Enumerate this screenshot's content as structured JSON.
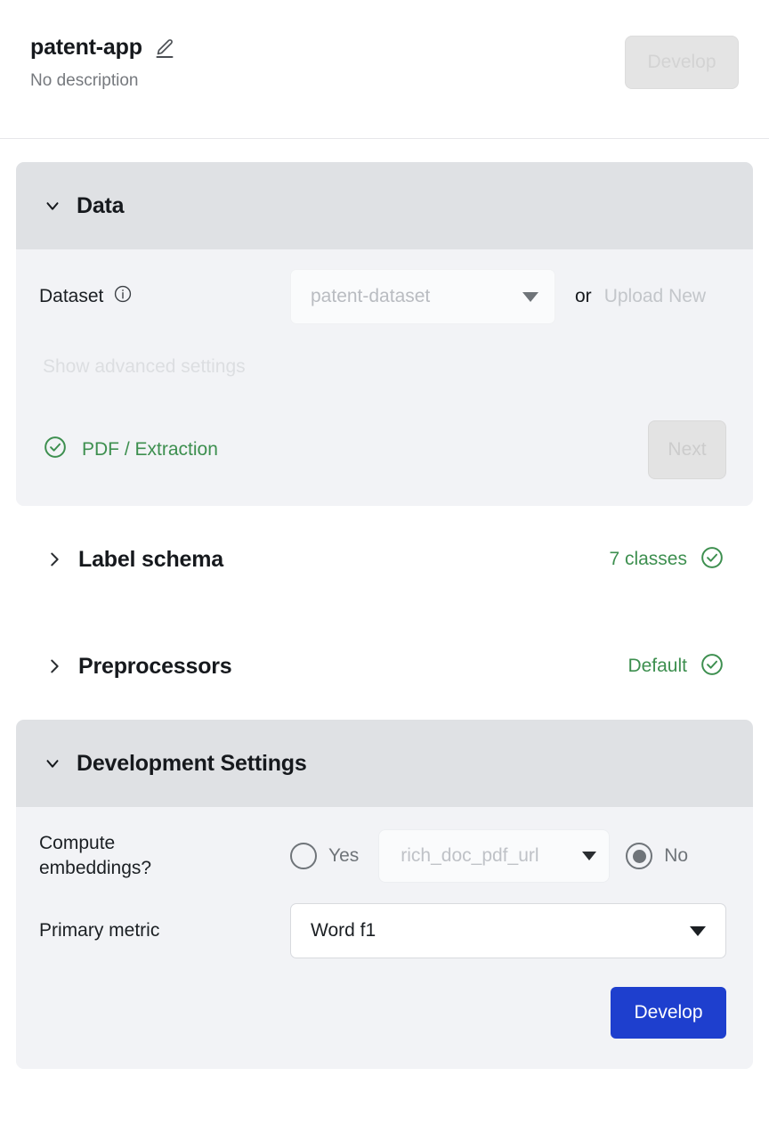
{
  "header": {
    "title": "patent-app",
    "subtitle": "No description",
    "edit_icon": "pencil-edit-icon",
    "develop_label": "Develop",
    "develop_disabled": true
  },
  "data_section": {
    "title": "Data",
    "expanded": true,
    "chevron": "chevron-down-icon",
    "dataset": {
      "label": "Dataset",
      "info_icon": "info-circle-icon",
      "value": "patent-dataset",
      "disabled": true,
      "or_text": "or",
      "upload_label": "Upload New",
      "upload_disabled": true
    },
    "advanced_link": "Show advanced settings",
    "status": {
      "icon": "check-circle-icon",
      "label": "PDF / Extraction",
      "color": "#3d8f4f"
    },
    "next_label": "Next",
    "next_disabled": true
  },
  "label_schema_section": {
    "title": "Label schema",
    "expanded": false,
    "chevron": "chevron-right-icon",
    "status_text": "7 classes",
    "status_icon": "check-circle-icon",
    "status_color": "#3d8f4f"
  },
  "preprocessors_section": {
    "title": "Preprocessors",
    "expanded": false,
    "chevron": "chevron-right-icon",
    "status_text": "Default",
    "status_icon": "check-circle-icon",
    "status_color": "#3d8f4f"
  },
  "development_settings": {
    "title": "Development Settings",
    "expanded": true,
    "chevron": "chevron-down-icon",
    "compute_embeddings": {
      "label": "Compute embeddings?",
      "label_line1": "Compute",
      "label_line2": "embeddings?",
      "yes_label": "Yes",
      "no_label": "No",
      "selected": "No",
      "column_value": "rich_doc_pdf_url",
      "column_disabled": true
    },
    "primary_metric": {
      "label": "Primary metric",
      "value": "Word f1"
    },
    "develop_label": "Develop",
    "develop_color": "#1e3fce"
  }
}
